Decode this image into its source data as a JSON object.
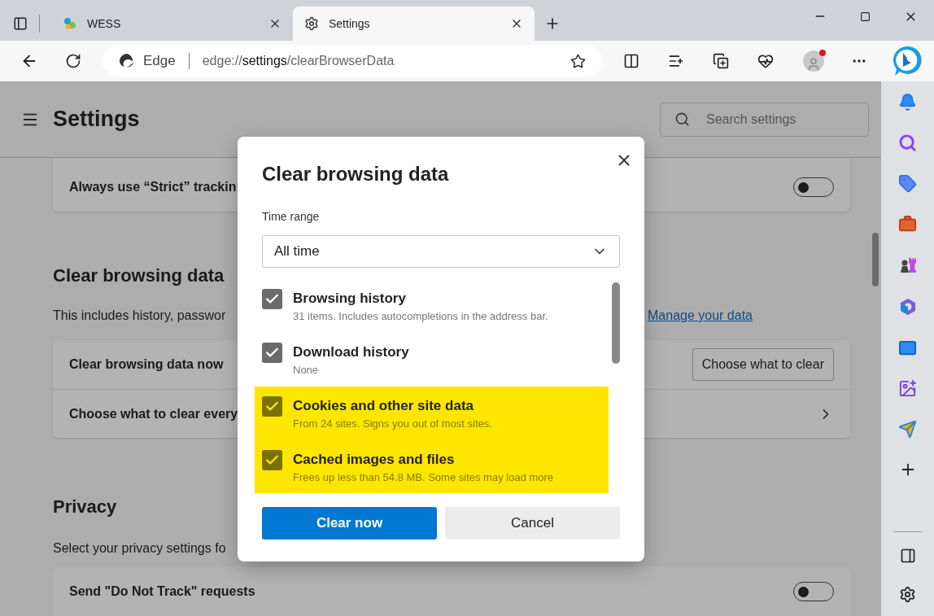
{
  "tabs": [
    {
      "title": "WESS",
      "selected": false
    },
    {
      "title": "Settings",
      "selected": true
    }
  ],
  "address_bar": {
    "site_label": "Edge",
    "url_scheme": "edge://",
    "url_host": "settings",
    "url_path": "/clearBrowserData"
  },
  "settings": {
    "title": "Settings",
    "search_placeholder": "Search settings",
    "tracking_row": {
      "label": "Always use “Strict” trackin",
      "on": false
    },
    "clear_section": {
      "heading": "Clear browsing data",
      "description": "This includes history, passwor",
      "link": "Manage your data",
      "rows": [
        {
          "kind": "button",
          "label": "Clear browsing data now",
          "button": "Choose what to clear"
        },
        {
          "kind": "chevron",
          "label": "Choose what to clear every"
        }
      ]
    },
    "privacy_section": {
      "heading": "Privacy",
      "description": "Select your privacy settings fo",
      "rows": [
        {
          "kind": "toggle",
          "label": "Send \"Do Not Track\" requests",
          "on": false
        }
      ]
    }
  },
  "dialog": {
    "title": "Clear browsing data",
    "time_range_label": "Time range",
    "time_range_value": "All time",
    "items": [
      {
        "label": "Browsing history",
        "detail": "31 items. Includes autocompletions in the address bar.",
        "checked": true,
        "highlighted": false
      },
      {
        "label": "Download history",
        "detail": "None",
        "checked": true,
        "highlighted": false
      },
      {
        "label": "Cookies and other site data",
        "detail": "From 24 sites. Signs you out of most sites.",
        "checked": true,
        "highlighted": true
      },
      {
        "label": "Cached images and files",
        "detail": "Frees up less than 54.8 MB. Some sites may load more",
        "checked": true,
        "highlighted": true
      }
    ],
    "primary_button": "Clear now",
    "secondary_button": "Cancel"
  }
}
